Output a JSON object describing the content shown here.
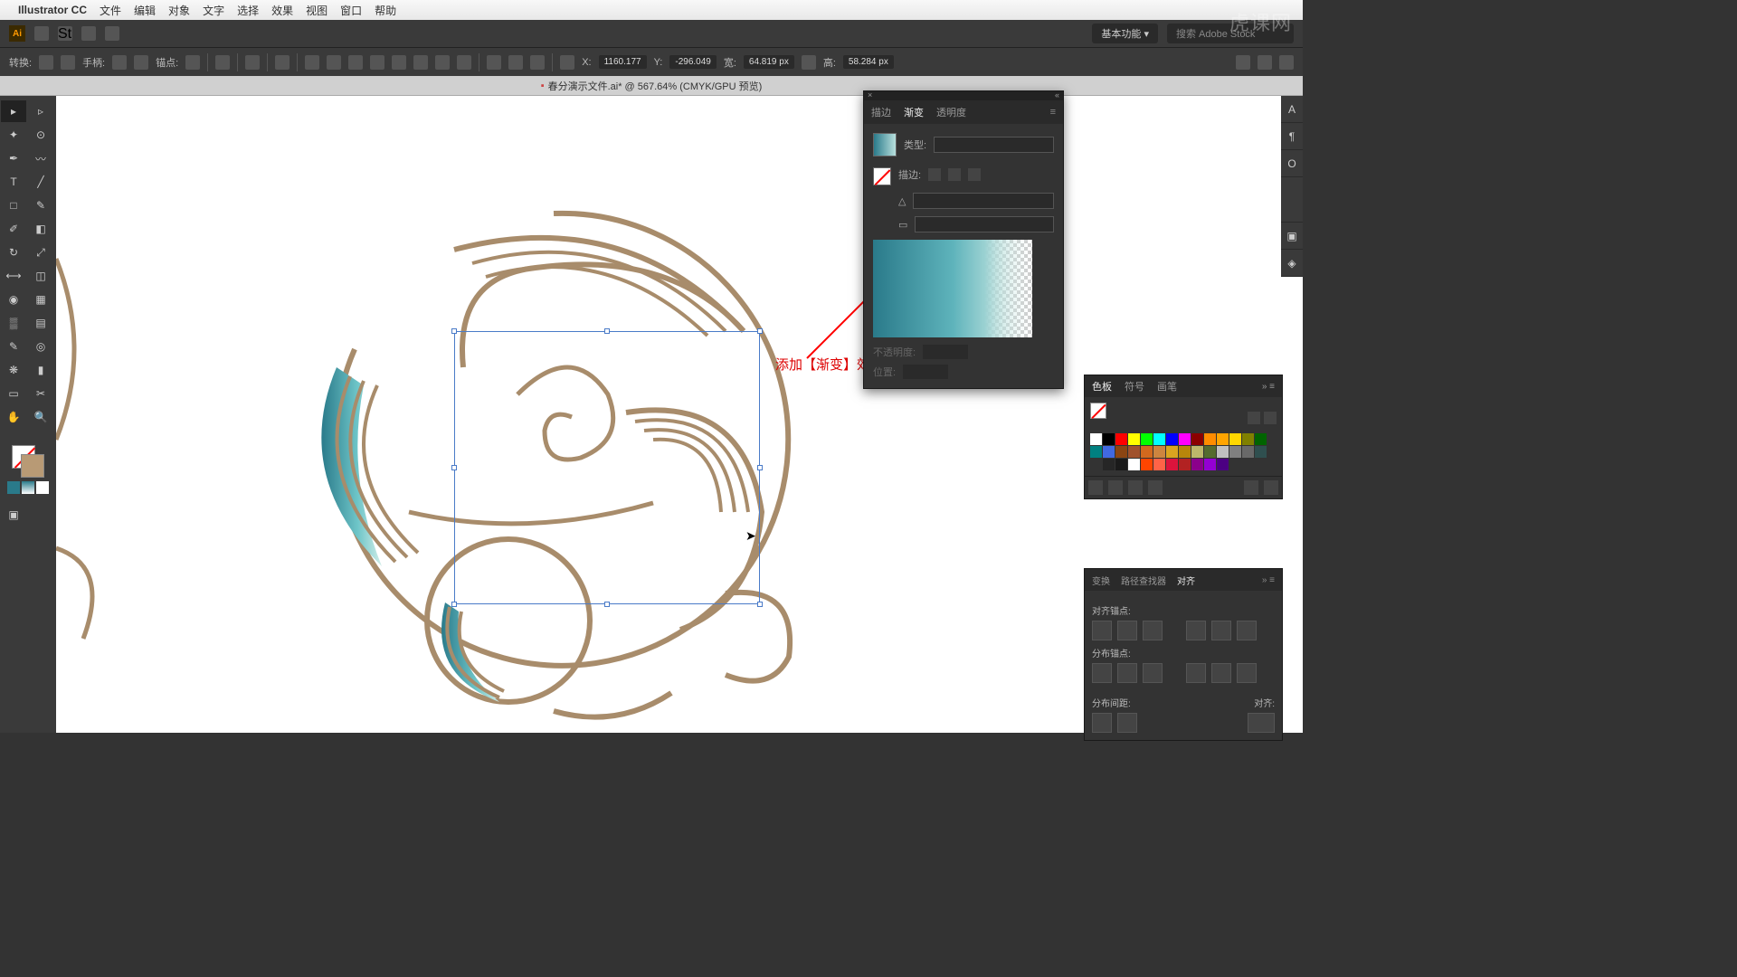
{
  "menubar": {
    "apple": "",
    "app": "Illustrator CC",
    "items": [
      "文件",
      "编辑",
      "对象",
      "文字",
      "选择",
      "效果",
      "视图",
      "窗口",
      "帮助"
    ]
  },
  "toptoolbar": {
    "workspace": "基本功能 ▾",
    "search_placeholder": "搜索 Adobe Stock"
  },
  "controlbar": {
    "transform": "转换:",
    "handle": "手柄:",
    "anchor": "锚点:",
    "x_lbl": "X:",
    "x_val": "1160.177",
    "y_lbl": "Y:",
    "y_val": "-296.049",
    "w_lbl": "宽:",
    "w_val": "64.819 px",
    "h_lbl": "高:",
    "h_val": "58.284 px"
  },
  "doc_title": "春分演示文件.ai* @ 567.64% (CMYK/GPU 预览)",
  "gradient_panel": {
    "tab_stroke": "描边",
    "tab_gradient": "渐变",
    "tab_transparency": "透明度",
    "type": "类型:",
    "stroke": "描边:",
    "opacity": "不透明度:",
    "location": "位置:"
  },
  "swatches_panel": {
    "tab_swatches": "色板",
    "tab_symbols": "符号",
    "tab_brushes": "画笔",
    "colors": [
      "#ffffff",
      "#000000",
      "#ff0000",
      "#ffff00",
      "#00ff00",
      "#00ffff",
      "#0000ff",
      "#ff00ff",
      "#8b0000",
      "#ff8c00",
      "#ffa500",
      "#ffd700",
      "#808000",
      "#006400",
      "#008080",
      "#4169e1",
      "#8b4513",
      "#a0522d",
      "#d2691e",
      "#cd853f",
      "#daa520",
      "#b8860b",
      "#bdb76b",
      "#556b2f",
      "#c0c0c0",
      "#808080",
      "#696969",
      "#2f4f4f",
      "#333333",
      "#262626",
      "#1a1a1a",
      "#ffffff",
      "#ff4500",
      "#ff6347",
      "#dc143c",
      "#b22222",
      "#8b008b",
      "#9400d3",
      "#4b0082"
    ]
  },
  "align_panel": {
    "tab_transform": "变换",
    "tab_pathfinder": "路径查找器",
    "tab_align": "对齐",
    "sect_anchors": "对齐锚点:",
    "sect_dist_anchors": "分布锚点:",
    "sect_dist_spacing": "分布间距:",
    "align_to": "对齐:"
  },
  "annotation": "添加【渐变】效果",
  "watermark": "虎课网"
}
